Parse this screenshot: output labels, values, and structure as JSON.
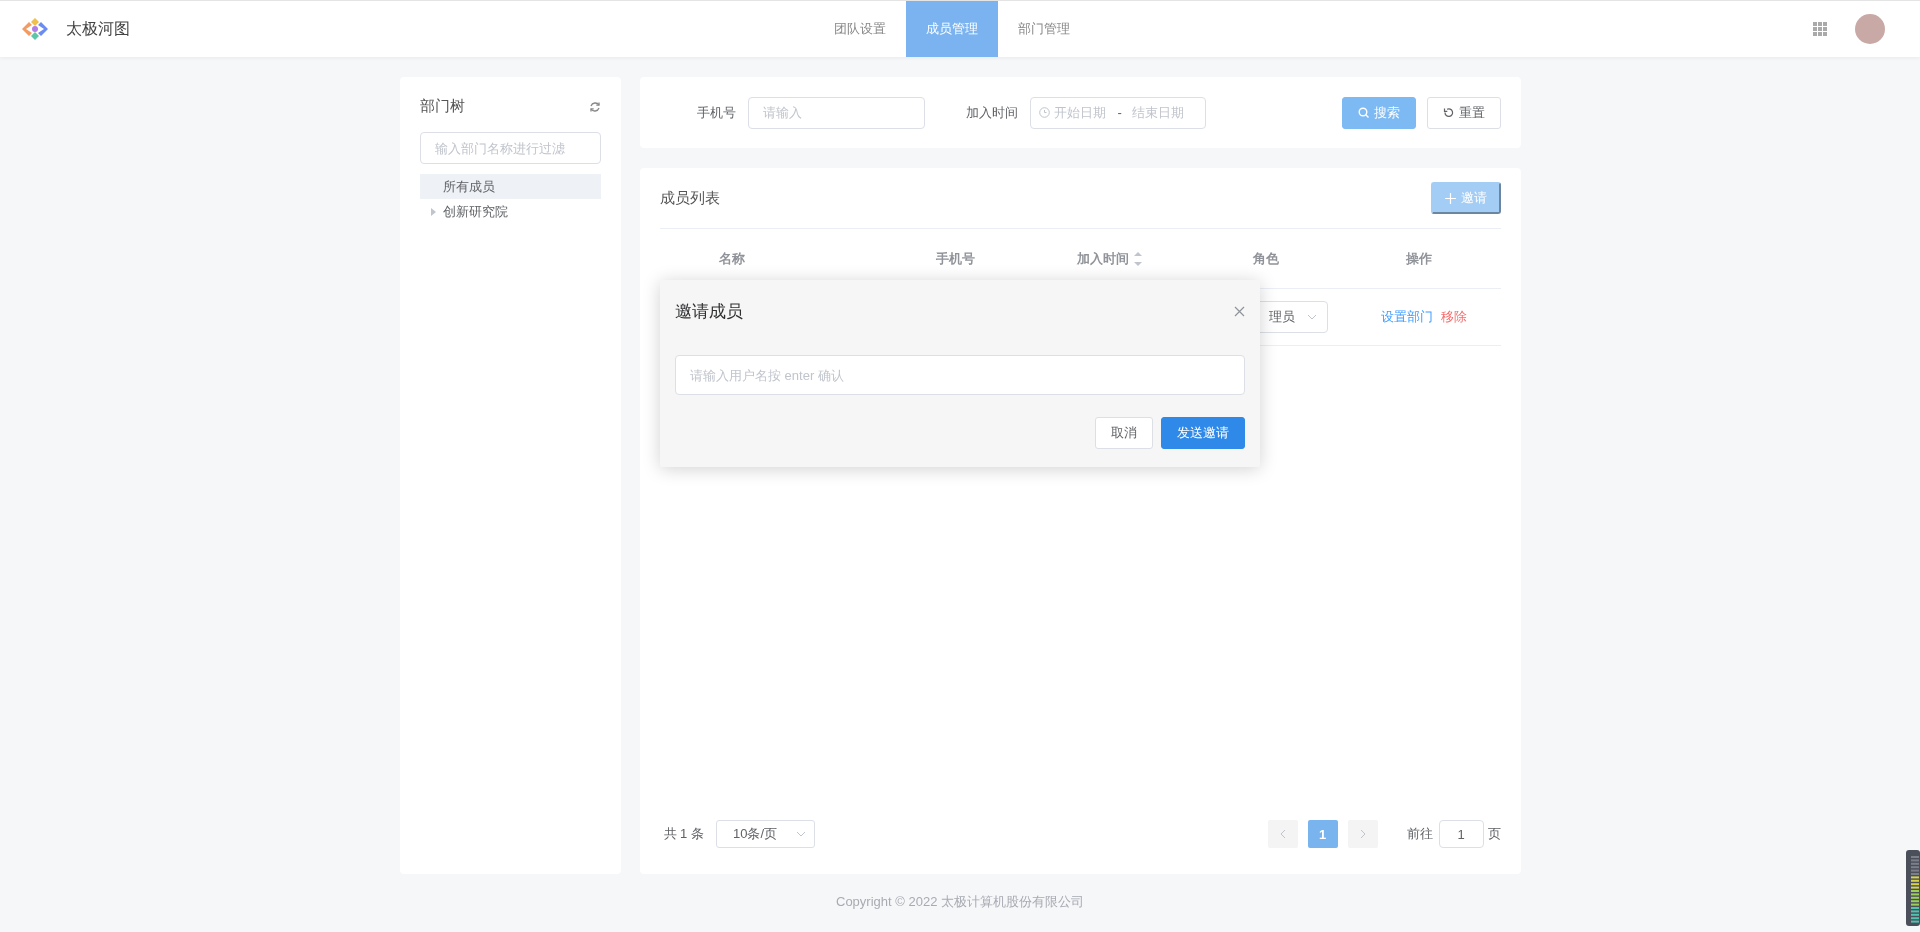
{
  "header": {
    "brand": "太极河图",
    "tabs": [
      {
        "label": "团队设置",
        "selected": false
      },
      {
        "label": "成员管理",
        "selected": true
      },
      {
        "label": "部门管理",
        "selected": false
      }
    ]
  },
  "dept_tree": {
    "title": "部门树",
    "filter": {
      "placeholder": "输入部门名称进行过滤"
    },
    "items": [
      {
        "label": "所有成员",
        "selected": true,
        "kind": "leaf"
      },
      {
        "label": "创新研究院",
        "selected": false,
        "kind": "branch"
      }
    ]
  },
  "search": {
    "fields": [
      {
        "kind": "text",
        "label": "手机号",
        "placeholder": "请输入"
      },
      {
        "kind": "daterange",
        "label": "加入时间",
        "start_placeholder": "开始日期",
        "separator": "-",
        "end_placeholder": "结束日期"
      }
    ],
    "buttons": [
      {
        "kind": "primary",
        "label": "搜索"
      },
      {
        "kind": "plain",
        "label": "重置"
      }
    ]
  },
  "members": {
    "title": "成员列表",
    "invite_button": "邀请",
    "columns": [
      {
        "label": "名称",
        "sortable": false
      },
      {
        "label": "手机号",
        "sortable": false
      },
      {
        "label": "加入时间",
        "sortable": true
      },
      {
        "label": "角色",
        "sortable": false
      },
      {
        "label": "操作",
        "sortable": false
      }
    ],
    "rows": [
      {
        "role": "理员",
        "actions": [
          {
            "kind": "link",
            "label": "设置部门"
          },
          {
            "kind": "danger",
            "label": "移除"
          }
        ]
      }
    ],
    "pagination": {
      "total": "共 1 条",
      "page_size": "10条/页",
      "pages": [
        {
          "label": "1",
          "selected": true
        }
      ],
      "goto_label": "前往",
      "goto_value": "1",
      "goto_suffix": "页"
    }
  },
  "footer": "Copyright © 2022 太极计算机股份有限公司",
  "dialog": {
    "title": "邀请成员",
    "input": {
      "placeholder": "请输入用户名按 enter 确认"
    },
    "buttons": [
      {
        "kind": "plain",
        "label": "取消"
      },
      {
        "kind": "primary",
        "label": "发送邀请"
      }
    ]
  }
}
